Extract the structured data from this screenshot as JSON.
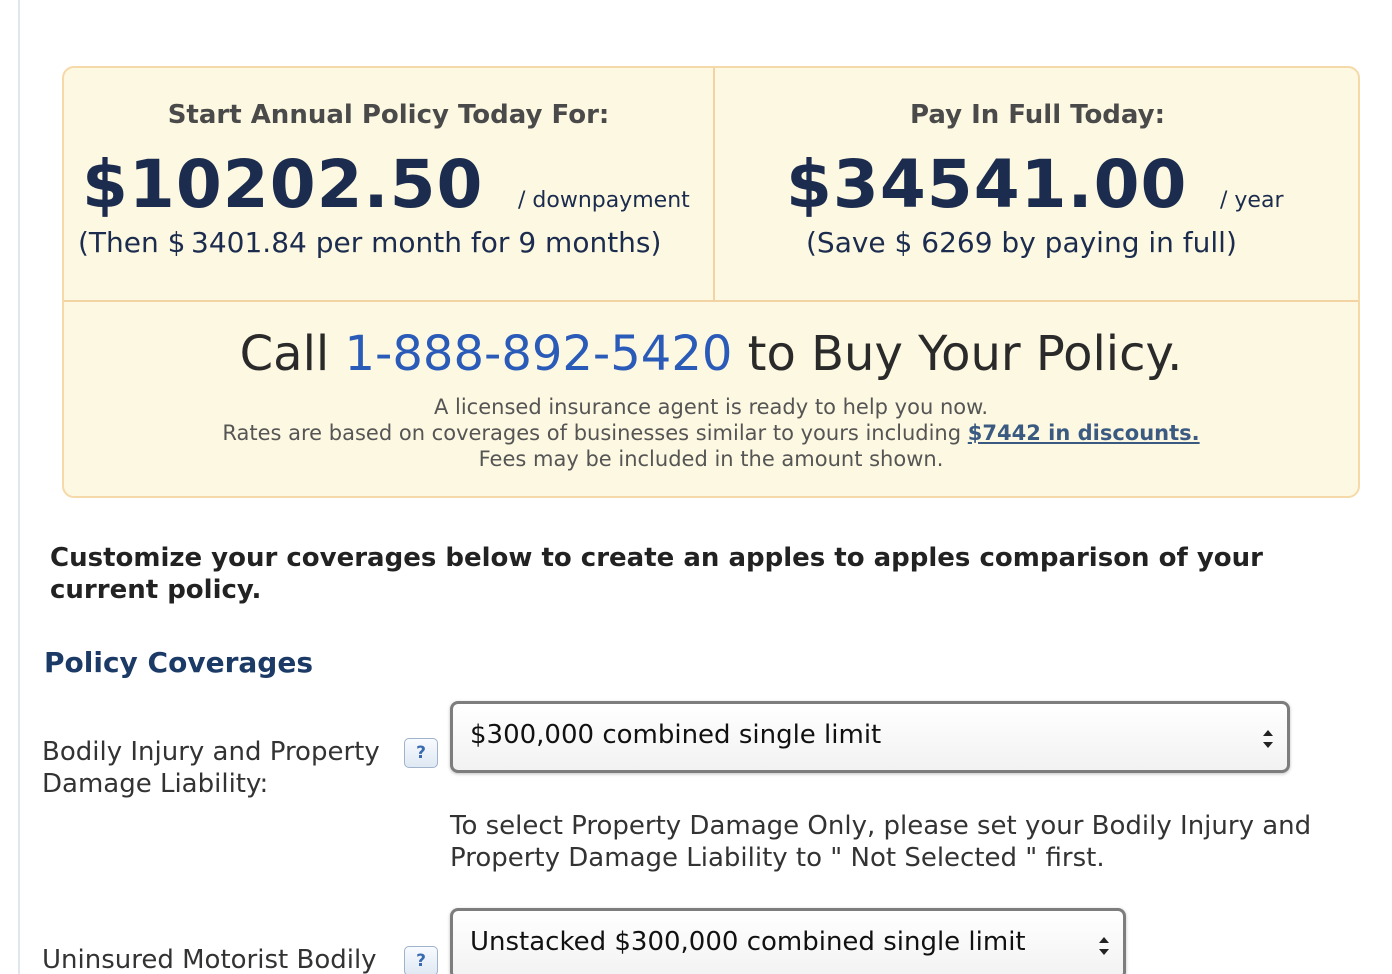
{
  "quote": {
    "annual": {
      "title": "Start Annual Policy Today For:",
      "price": "$10202.50",
      "suffix": "/ downpayment",
      "subline": "(Then $ 3401.84  per month for 9  months)"
    },
    "full": {
      "title": "Pay In Full Today:",
      "price": "$34541.00",
      "suffix": "/ year",
      "subline": "(Save $ 6269  by paying in full)"
    },
    "call": {
      "prefix": "Call",
      "phone": "1-888-892-5420",
      "suffix": "to Buy Your Policy."
    },
    "agent_line": "A licensed insurance agent is ready to help you now.",
    "rates_line": "Rates are based on coverages of businesses similar to yours including",
    "discount_link": "$7442 in discounts.",
    "fees_line": "Fees may be included in the amount shown."
  },
  "customize_text": "Customize your coverages below to create an apples to apples comparison of your current policy.",
  "coverages": {
    "heading": "Policy Coverages",
    "bodily_injury": {
      "label": "Bodily Injury and Property Damage Liability:",
      "help": "?",
      "selected": "$300,000 combined single limit",
      "note": "To select Property Damage Only, please set your Bodily Injury and Property Damage Liability to \" Not Selected \" first."
    },
    "uninsured": {
      "label": "Uninsured Motorist Bodily",
      "help": "?",
      "selected": "Unstacked $300,000 combined single limit"
    }
  },
  "colors": {
    "box_bg": "#fdf8e1",
    "box_border": "#f6d9a8",
    "price_navy": "#1b2c4e",
    "phone_blue": "#2a5bb8",
    "heading_blue": "#1b3a66"
  }
}
